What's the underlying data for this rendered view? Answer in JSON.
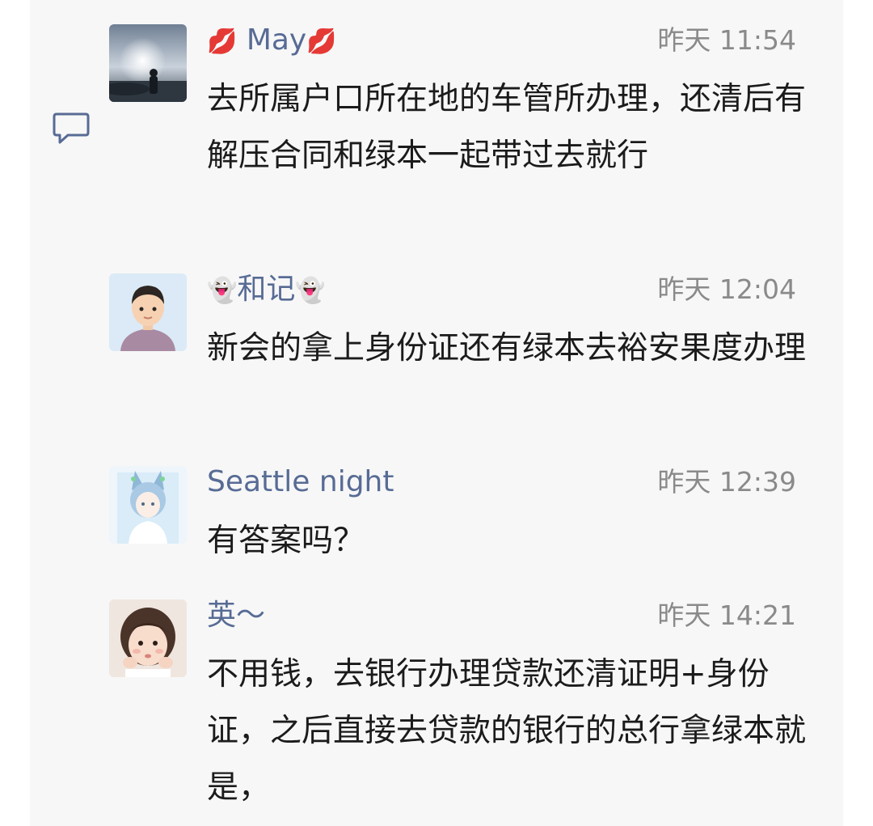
{
  "comments": [
    {
      "name_prefix": "💋",
      "name": "May",
      "name_suffix": "💋",
      "time": "昨天 11:54",
      "text": "去所属户口所在地的车管所办理，还清后有解压合同和绿本一起带过去就行",
      "avatar": "sunset-silhouette-avatar"
    },
    {
      "name_prefix": "👻",
      "name": "和记",
      "name_suffix": "👻",
      "time": "昨天 12:04",
      "text": "新会的拿上身份证还有绿本去裕安果度办理",
      "avatar": "cartoon-boy-avatar"
    },
    {
      "name_prefix": "",
      "name": "Seattle night",
      "name_suffix": "",
      "time": "昨天 12:39",
      "text": "有答案吗？",
      "avatar": "anime-catgirl-avatar"
    },
    {
      "name_prefix": "",
      "name": "英～",
      "name_suffix": "",
      "time": "昨天 14:21",
      "text": "不用钱，去银行办理贷款还清证明+身份证，之后直接去贷款的银行的总行拿绿本就是，",
      "avatar": "little-girl-avatar"
    }
  ],
  "icons": {
    "comment": "comment-bubble-icon"
  },
  "colors": {
    "name": "#576b95",
    "time": "#8a8a8a",
    "text": "#1b1b1b",
    "panel": "#f7f7f7"
  }
}
